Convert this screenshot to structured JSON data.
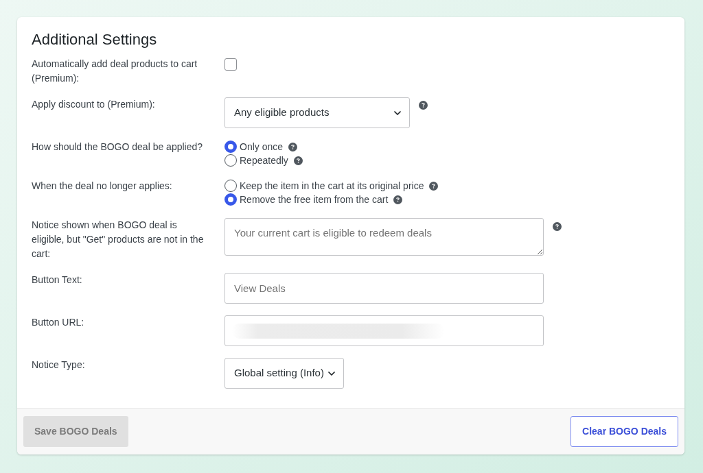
{
  "panel": {
    "title": "Additional Settings"
  },
  "settings": [
    {
      "kind": "checkbox",
      "label": "Automatically add deal products to cart (Premium):",
      "checked": false,
      "help": false
    },
    {
      "kind": "select",
      "label": "Apply discount to (Premium):",
      "value": "Any eligible products",
      "help": true
    },
    {
      "kind": "radio",
      "label": "How should the BOGO deal be applied?",
      "help": false,
      "options": [
        {
          "label": "Only once",
          "selected": true,
          "help": true
        },
        {
          "label": "Repeatedly",
          "selected": false,
          "help": true
        }
      ]
    },
    {
      "kind": "radio",
      "label": "When the deal no longer applies:",
      "help": false,
      "options": [
        {
          "label": "Keep the item in the cart at its original price",
          "selected": false,
          "help": true
        },
        {
          "label": "Remove the free item from the cart",
          "selected": true,
          "help": true
        }
      ]
    },
    {
      "kind": "textarea",
      "label": "Notice shown when BOGO deal is eligible, but \"Get\" products are not in the cart:",
      "placeholder": "Your current cart is eligible to redeem deals",
      "help": true
    },
    {
      "kind": "text",
      "label": "Button Text:",
      "placeholder": "View Deals",
      "redacted": false,
      "help": false
    },
    {
      "kind": "text",
      "label": "Button URL:",
      "redacted": true,
      "help": false
    },
    {
      "kind": "select",
      "label": "Notice Type:",
      "value": "Global setting (Info)",
      "help": false
    }
  ],
  "footer": {
    "buttons": [
      {
        "label": "Save BOGO Deals",
        "disabled": true
      },
      {
        "label": "Clear BOGO Deals",
        "disabled": false
      }
    ]
  }
}
